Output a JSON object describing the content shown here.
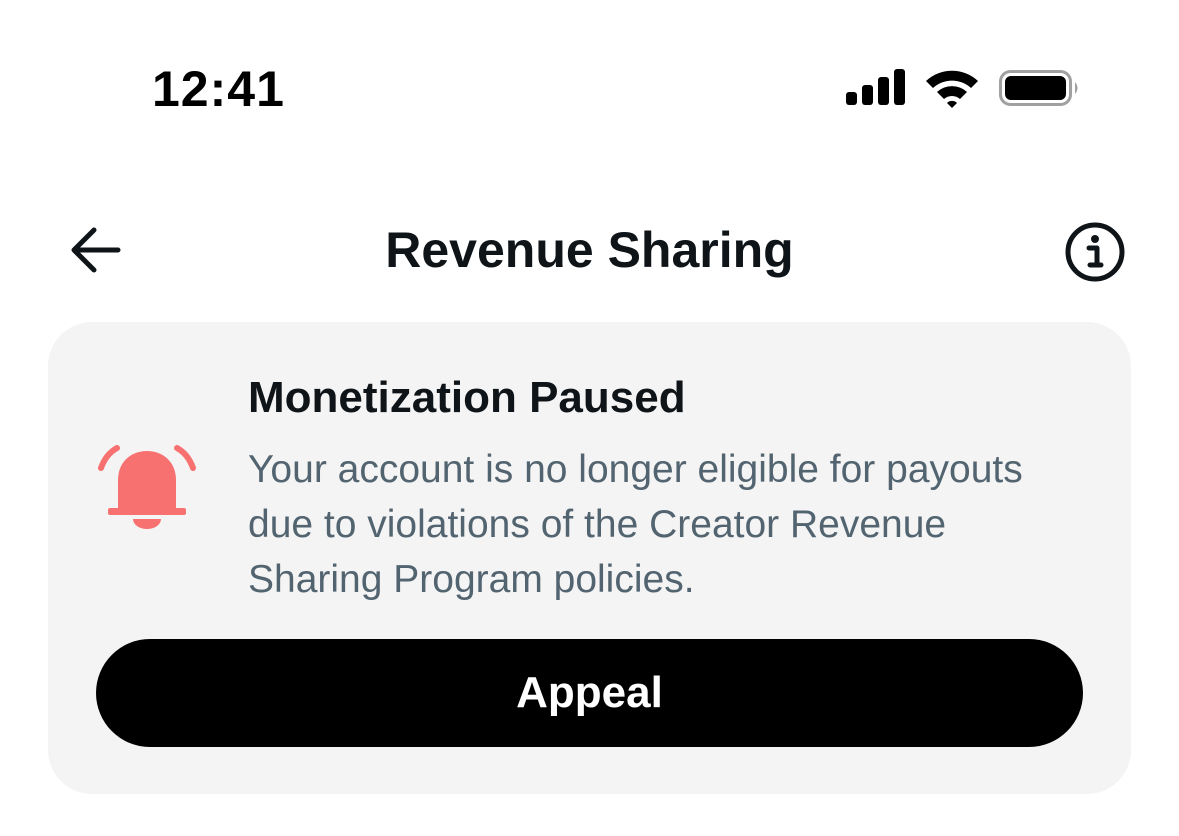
{
  "status_bar": {
    "time": "12:41",
    "icons": [
      "cellular-signal-icon",
      "wifi-icon",
      "battery-icon"
    ]
  },
  "header": {
    "back_icon": "arrow-left-icon",
    "title": "Revenue Sharing",
    "info_icon": "info-icon"
  },
  "notice_card": {
    "icon": "bell-alert-icon",
    "title": "Monetization Paused",
    "body": "Your account is no longer eligible for payouts due to violations of the Creator Revenue Sharing Program policies.",
    "button_label": "Appeal"
  },
  "colors": {
    "bell": "#f87171",
    "card_background": "#f4f4f4",
    "button_background": "#000000",
    "body_text": "#536471"
  }
}
